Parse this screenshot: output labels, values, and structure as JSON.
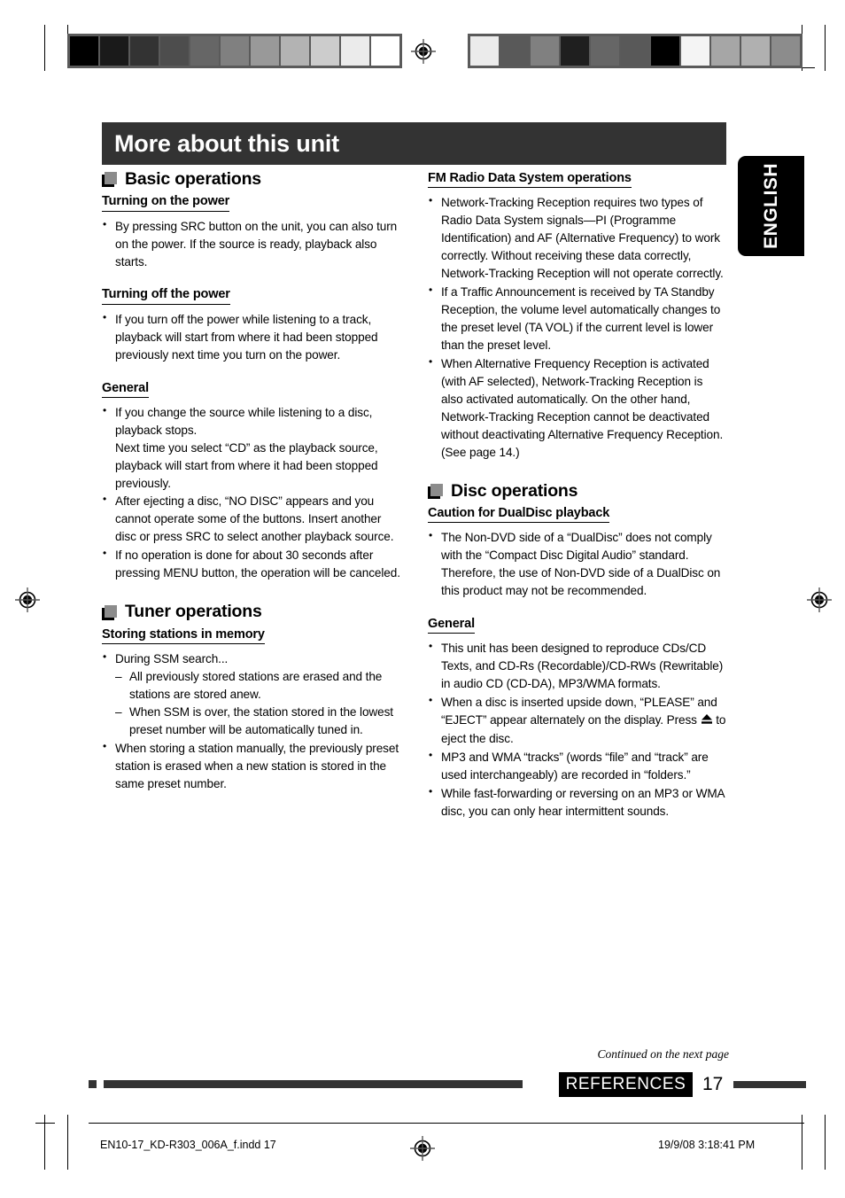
{
  "language_tab": "ENGLISH",
  "title": "More about this unit",
  "left_column": {
    "sections": [
      {
        "icon": "filled-square-icon",
        "heading": "Basic operations",
        "groups": [
          {
            "sub_heading": "Turning on the power",
            "bullets": [
              "By pressing SRC button on the unit, you can also turn on the power. If the source is ready, playback also starts."
            ]
          },
          {
            "sub_heading": "Turning off the power",
            "bullets": [
              "If you turn off the power while listening to a track, playback will start from where it had been stopped previously next time you turn on the power."
            ]
          },
          {
            "sub_heading": "General",
            "bullets": [
              "If you change the source while listening to a disc, playback stops.",
              "After ejecting a disc, “NO DISC” appears and you cannot operate some of the buttons. Insert another disc or press SRC to select another playback source.",
              "If no operation is done for about 30 seconds after pressing MENU button, the operation will be canceled."
            ],
            "bullet1_continuation": "Next time you select “CD” as the playback source, playback will start from where it had been stopped previously."
          }
        ]
      },
      {
        "icon": "filled-square-icon",
        "heading": "Tuner operations",
        "groups": [
          {
            "sub_heading": "Storing stations in memory",
            "bullets": [
              "During SSM search...",
              "When storing a station manually, the previously preset station is erased when a new station is stored in the same preset number."
            ],
            "sub_bullets": [
              "All previously stored stations are erased and the stations are stored anew.",
              "When SSM is over, the station stored in the lowest preset number will be automatically tuned in."
            ]
          }
        ]
      }
    ]
  },
  "right_column": {
    "fm_section": {
      "sub_heading": "FM Radio Data System operations",
      "bullets": [
        "Network-Tracking Reception requires two types of Radio Data System signals—PI (Programme Identification) and AF (Alternative Frequency) to work correctly. Without receiving these data correctly, Network-Tracking Reception will not operate correctly.",
        "If a Traffic Announcement is received by TA Standby Reception, the volume level automatically changes to the preset level (TA VOL) if the current level is lower than the preset level.",
        "When Alternative Frequency Reception is activated (with AF selected), Network-Tracking Reception is also activated automatically. On the other hand, Network-Tracking Reception cannot be deactivated without deactivating Alternative Frequency Reception. (See page 14.)"
      ]
    },
    "disc_section": {
      "icon": "filled-square-icon",
      "heading": "Disc operations",
      "groups": [
        {
          "sub_heading": "Caution for DualDisc playback",
          "bullets": [
            "The Non-DVD side of a “DualDisc” does not comply with the “Compact Disc Digital Audio” standard. Therefore, the use of Non-DVD side of a DualDisc on this product may not be recommended."
          ]
        },
        {
          "sub_heading": "General",
          "bullets": [
            "This unit has been designed to reproduce CDs/CD Texts, and CD-Rs (Recordable)/CD-RWs (Rewritable) in audio CD (CD-DA), MP3/WMA formats.",
            "MP3 and WMA “tracks” (words “file” and “track” are used interchangeably) are recorded in “folders.”",
            "While fast-forwarding or reversing on an MP3 or WMA disc, you can only hear intermittent sounds."
          ],
          "eject_bullet_pre": "When a disc is inserted upside down, “PLEASE” and “EJECT” appear alternately on the display. Press",
          "eject_bullet_post": "to eject the disc.",
          "eject_symbol": "⏏"
        }
      ]
    }
  },
  "footer": {
    "continued": "Continued on the next page",
    "section_badge": "REFERENCES",
    "page_number": "17",
    "print_meta_left": "EN10-17_KD-R303_006A_f.indd   17",
    "print_meta_right": "19/9/08   3:18:41 PM"
  },
  "print_bars": {
    "left_wedge": [
      "#000000",
      "#1a1a1a",
      "#333333",
      "#4d4d4d",
      "#666666",
      "#808080",
      "#999999",
      "#b3b3b3",
      "#cccccc",
      "#ebebeb",
      "#ffffff"
    ],
    "right_wedge": [
      "#ebebeb",
      "#595959",
      "#808080",
      "#1f1f1f",
      "#666666",
      "#595959",
      "#000000",
      "#f4f4f4",
      "#a6a6a6",
      "#b0b0b0",
      "#8c8c8c"
    ]
  }
}
